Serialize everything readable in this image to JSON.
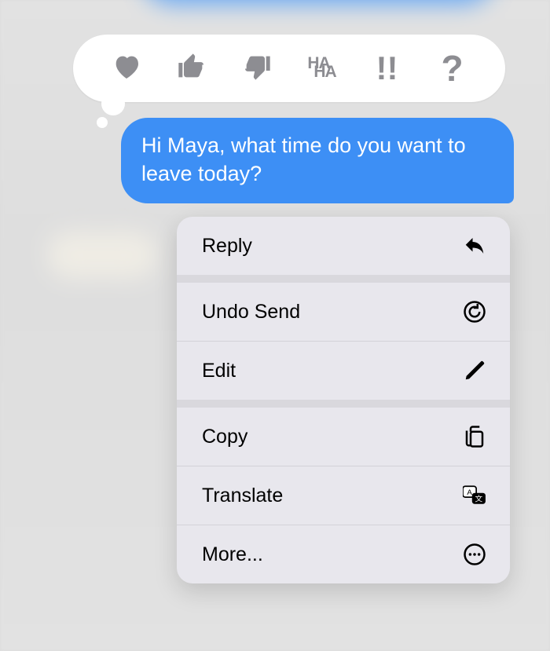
{
  "reactions": {
    "heart": "heart",
    "thumbs_up": "thumbs-up",
    "thumbs_down": "thumbs-down",
    "haha_line1": "HA",
    "haha_line2": "HA",
    "exclaim": "!!",
    "question": "?"
  },
  "message": {
    "text": "Hi Maya, what time do you want to leave today?",
    "bubble_color": "#3d8ff5"
  },
  "menu": {
    "reply": "Reply",
    "undo_send": "Undo Send",
    "edit": "Edit",
    "copy": "Copy",
    "translate": "Translate",
    "more": "More..."
  }
}
